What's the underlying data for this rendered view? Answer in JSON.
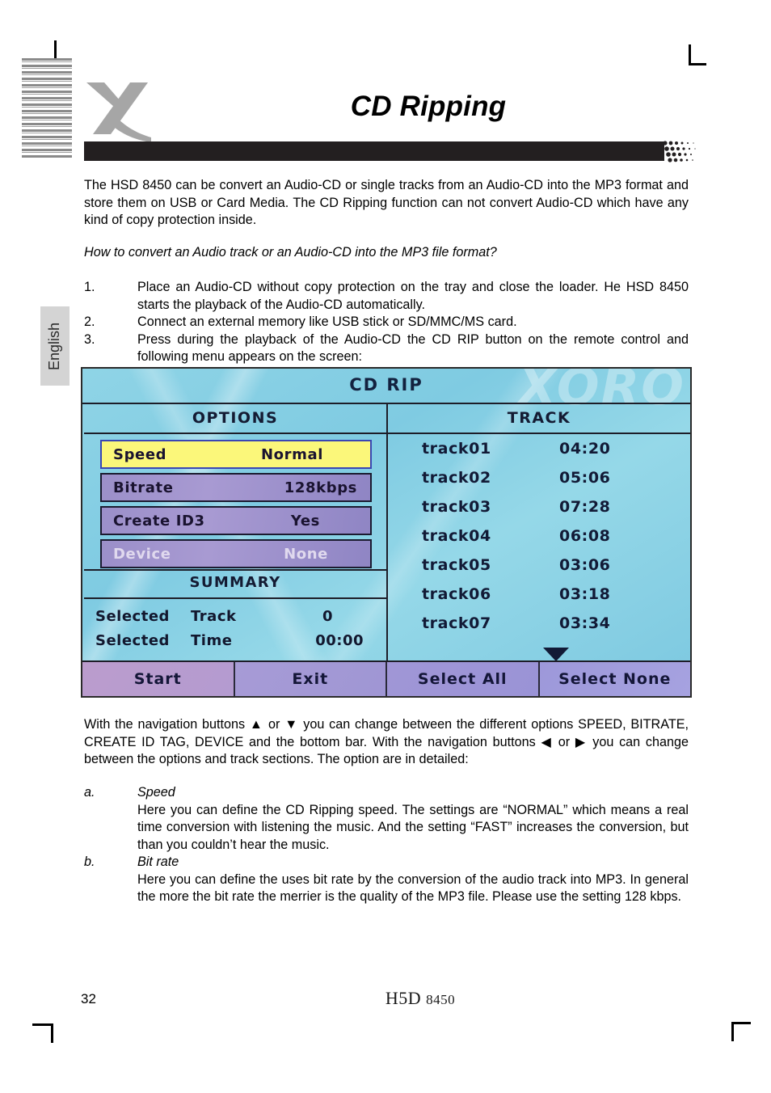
{
  "page": {
    "title": "CD Ripping",
    "language_tab": "English",
    "page_number": "32",
    "footer_logo_main": "H",
    "footer_logo_mid": "D",
    "footer_logo_model": "8450"
  },
  "intro": {
    "paragraph": "The HSD 8450 can be convert an Audio-CD or single tracks from an Audio-CD into the MP3 format and store them on USB or Card Media. The CD Ripping function can not convert Audio-CD which have any kind of copy protection inside.",
    "question": "How to convert an Audio track or an Audio-CD into the MP3 file format?"
  },
  "steps": [
    {
      "num": "1.",
      "text": "Place an Audio-CD without copy protection on the tray and close the loader. He HSD 8450 starts the playback of the Audio-CD automatically."
    },
    {
      "num": "2.",
      "text": "Connect an external memory like USB stick or SD/MMC/MS card."
    },
    {
      "num": "3.",
      "text": "Press during the playback of the Audio-CD the CD RIP button on the remote control and following menu appears on the screen:"
    }
  ],
  "osd": {
    "title": "CD  RIP",
    "watermark": "XORO",
    "options_heading": "OPTIONS",
    "track_heading": "TRACK",
    "summary_heading": "SUMMARY",
    "options": [
      {
        "label": "Speed",
        "value": "Normal",
        "state": "highlight"
      },
      {
        "label": "Bitrate",
        "value": "128kbps",
        "state": "normal"
      },
      {
        "label": "Create ID3",
        "value": "Yes",
        "state": "normal"
      },
      {
        "label": "Device",
        "value": "None",
        "state": "dim"
      }
    ],
    "summary": [
      {
        "key1": "Selected",
        "key2": "Track",
        "value": "0"
      },
      {
        "key1": "Selected",
        "key2": "Time",
        "value": "00:00"
      }
    ],
    "tracks": [
      {
        "name": "track01",
        "time": "04:20"
      },
      {
        "name": "track02",
        "time": "05:06"
      },
      {
        "name": "track03",
        "time": "07:28"
      },
      {
        "name": "track04",
        "time": "06:08"
      },
      {
        "name": "track05",
        "time": "03:06"
      },
      {
        "name": "track06",
        "time": "03:18"
      },
      {
        "name": "track07",
        "time": "03:34"
      }
    ],
    "buttons": [
      "Start",
      "Exit",
      "Select  All",
      "Select  None"
    ],
    "colors": {
      "screen_bg": "#8fd4e6",
      "row_highlight": "#fbf77a",
      "row_normal": "#a89ad2",
      "button_bar": "#a79bd6",
      "text_dark": "#141b33"
    }
  },
  "navigation": {
    "paragraph": "With the navigation buttons ▲  or ▼  you can change between the different options SPEED, BITRATE, CREATE ID TAG, DEVICE and the bottom bar. With the navigation buttons ◀  or ▶  you can change between the options and track sections. The option are in detailed:"
  },
  "details": [
    {
      "letter": "a.",
      "heading": "Speed",
      "body": "Here you can define the CD Ripping speed. The settings are “NORMAL” which means a real time conversion with listening the music. And the setting “FAST” increases the conversion, but than you couldn’t hear the music."
    },
    {
      "letter": "b.",
      "heading": "Bit rate",
      "body": "Here you can define the uses bit rate by the conversion of the audio track into MP3. In general the more the bit rate the merrier is the quality of the MP3 file. Please use the setting 128 kbps."
    }
  ]
}
